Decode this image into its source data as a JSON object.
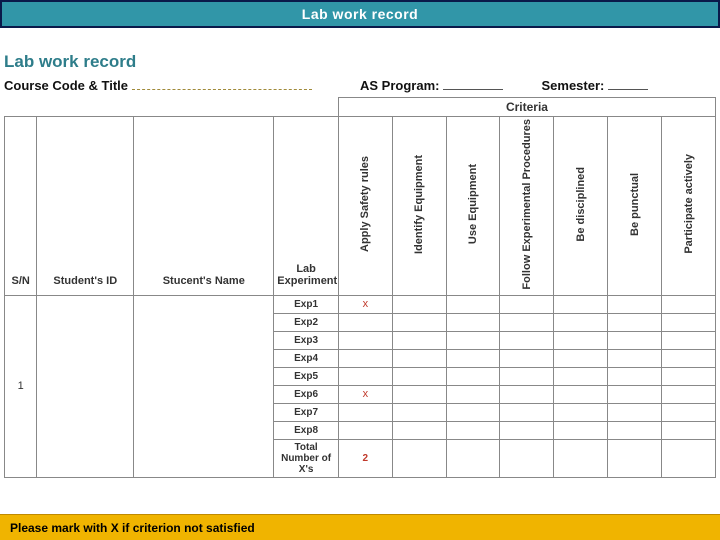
{
  "banner": {
    "title": "Lab work record"
  },
  "doc": {
    "title": "Lab work record",
    "meta": {
      "course_label": "Course Code & Title",
      "program_label": "AS Program:",
      "semester_label": "Semester:"
    },
    "headers": {
      "criteria": "Criteria",
      "sn": "S/N",
      "student_id": "Student's ID",
      "student_name": "Stucent's Name",
      "lab_experiment": "Lab Experiment",
      "c1": "Apply Safety rules",
      "c2": "Identify Equipment",
      "c3": "Use Equipment",
      "c4": "Follow Experimental Procedures",
      "c5": "Be disciplined",
      "c6": "Be punctual",
      "c7": "Participate actively"
    },
    "rows": {
      "sn1": "1",
      "exp": [
        "Exp1",
        "Exp2",
        "Exp3",
        "Exp4",
        "Exp5",
        "Exp6",
        "Exp7",
        "Exp8"
      ],
      "total_label": "Total Number of X's",
      "marks": {
        "exp1_c1": "x",
        "exp6_c1": "x",
        "total_c1": "2"
      }
    }
  },
  "footer": {
    "note": "Please mark with X if criterion not satisfied"
  }
}
